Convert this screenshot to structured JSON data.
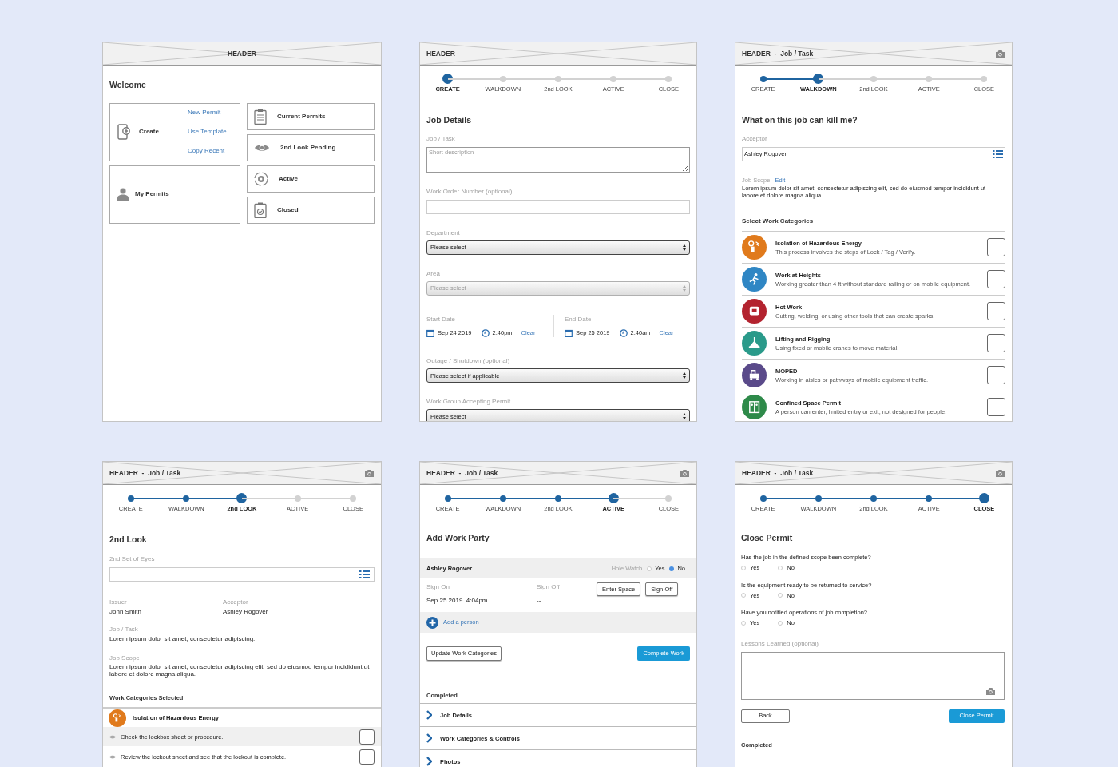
{
  "screens": [
    {
      "kind": "home",
      "header": "HEADER",
      "title": "Welcome",
      "create": {
        "label": "Create",
        "links": [
          "New Permit",
          "Use Template",
          "Copy Recent"
        ]
      },
      "my_permits": "My Permits",
      "tiles": [
        "Current Permits",
        "2nd Look Pending",
        "Active",
        "Closed"
      ]
    },
    {
      "kind": "job_details",
      "header": "HEADER",
      "steps": [
        {
          "label": "CREATE",
          "selected": true
        },
        {
          "label": "WALKDOWN",
          "done": false,
          "selected": false
        },
        {
          "label": "2nd LOOK",
          "done": false,
          "selected": false
        },
        {
          "label": "ACTIVE",
          "done": false,
          "selected": false
        },
        {
          "label": "CLOSE",
          "done": false,
          "selected": false
        }
      ],
      "title": "Job Details",
      "fields": [
        {
          "kind": "textarea",
          "label": "Job / Task",
          "placeholder": "Short description"
        },
        {
          "kind": "input",
          "label": "Work Order Number (optional)"
        },
        {
          "kind": "select",
          "label": "Department",
          "value": "Please select",
          "disabled": false
        },
        {
          "kind": "select",
          "label": "Area",
          "value": "Please select",
          "disabled": true
        },
        {
          "kind": "dates",
          "start": {
            "label": "Start Date",
            "date": "Sep 24 2019",
            "time": "2:40pm",
            "action": "Clear"
          },
          "end": {
            "label": "End Date",
            "date": "Sep 25 2019",
            "time": "2:40am",
            "action": "Clear"
          }
        },
        {
          "kind": "select",
          "label": "Outage / Shutdown (optional)",
          "value": "Please select if applicable",
          "disabled": false
        },
        {
          "kind": "select",
          "label": "Work Group Accepting Permit",
          "value": "Please select",
          "disabled": false
        }
      ]
    },
    {
      "kind": "walkdown",
      "header": "HEADER  -  Job / Task",
      "camera": true,
      "steps": [
        {
          "label": "CREATE",
          "done": true,
          "selected": false
        },
        {
          "label": "WALKDOWN",
          "selected": true
        },
        {
          "label": "2nd LOOK",
          "done": false,
          "selected": false
        },
        {
          "label": "ACTIVE",
          "done": false,
          "selected": false
        },
        {
          "label": "CLOSE",
          "done": false,
          "selected": false
        }
      ],
      "title": "What on this job can kill me?",
      "acceptor": {
        "label": "Acceptor",
        "value": "Ashley Rogover"
      },
      "scope": {
        "label": "Job Scope",
        "action": "Edit",
        "text": "Lorem ipsum dolor sit amet, consectetur adipiscing elit, sed do eiusmod tempor incididunt ut labore et dolore magna aliqua."
      },
      "section": "Select Work Categories",
      "categories": [
        {
          "name": "Isolation of Hazardous Energy",
          "description": "This process involves the steps of Lock / Tag / Verify.",
          "color": "#e07a1c",
          "checked": false
        },
        {
          "name": "Work at Heights",
          "description": "Working greater than 4 ft without standard railing or on mobile equipment.",
          "color": "#2f86c4",
          "checked": false
        },
        {
          "name": "Hot Work",
          "description": "Cutting, welding, or using other tools that can create sparks.",
          "color": "#b3232f",
          "checked": false
        },
        {
          "name": "Lifting and Rigging",
          "description": "Using fixed or mobile cranes to move material.",
          "color": "#2a9a8a",
          "checked": false
        },
        {
          "name": "MOPED",
          "description": "Working in aisles or pathways of mobile equipment traffic.",
          "color": "#5a4a8a",
          "checked": false
        },
        {
          "name": "Confined Space Permit",
          "description": "A person can enter, limited entry or exit, not designed for people.",
          "color": "#2e8a4a",
          "checked": false
        }
      ]
    },
    {
      "kind": "second_look",
      "header": "HEADER  -  Job / Task",
      "camera": true,
      "steps": [
        {
          "label": "CREATE",
          "done": true,
          "selected": false
        },
        {
          "label": "WALKDOWN",
          "done": true,
          "selected": false
        },
        {
          "label": "2nd LOOK",
          "selected": true
        },
        {
          "label": "ACTIVE",
          "done": false,
          "selected": false
        },
        {
          "label": "CLOSE",
          "done": false,
          "selected": false
        }
      ],
      "title": "2nd Look",
      "eyes_label": "2nd Set of Eyes",
      "issuer": {
        "label": "Issuer",
        "value": "John Smith"
      },
      "acceptor": {
        "label": "Acceptor",
        "value": "Ashley Rogover"
      },
      "job_task": {
        "label": "Job / Task",
        "value": "Lorem ipsum dolor sit amet, consectetur adipiscing."
      },
      "job_scope": {
        "label": "Job Scope",
        "value": "Lorem ipsum dolor sit amet, consectetur adipiscing elit, sed do eiusmod tempor incididunt ut labore et dolore magna aliqua."
      },
      "section": "Work Categories Selected",
      "category": {
        "name": "Isolation of Hazardous Energy",
        "color": "#e07a1c"
      },
      "checks": [
        {
          "text": "Check the lockbox sheet or procedure.",
          "checked": false
        },
        {
          "text": "Review the lockout sheet and see that the lockout is complete.",
          "checked": false
        }
      ]
    },
    {
      "kind": "active",
      "header": "HEADER  -  Job / Task",
      "camera": true,
      "steps": [
        {
          "label": "CREATE",
          "done": true,
          "selected": false
        },
        {
          "label": "WALKDOWN",
          "done": true,
          "selected": false
        },
        {
          "label": "2nd LOOK",
          "done": true,
          "selected": false
        },
        {
          "label": "ACTIVE",
          "selected": true
        },
        {
          "label": "CLOSE",
          "done": false,
          "selected": false
        }
      ],
      "title": "Add Work Party",
      "person": {
        "name": "Ashley Rogover",
        "hole_watch": "Hole Watch",
        "options": [
          {
            "label": "Yes",
            "selected": false
          },
          {
            "label": "No",
            "selected": true
          }
        ],
        "sign_on": {
          "label": "Sign On",
          "value": "Sep 25 2019  4:04pm"
        },
        "sign_off": {
          "label": "Sign Off",
          "value": "--"
        },
        "buttons": [
          "Enter Space",
          "Sign Off"
        ]
      },
      "add_person": "Add a person",
      "secondary_button": "Update Work Categories",
      "primary_button": "Complete Work",
      "completed": "Completed",
      "sections": [
        "Job Details",
        "Work Categories & Controls",
        "Photos"
      ]
    },
    {
      "kind": "close",
      "header": "HEADER  -  Job / Task",
      "camera": true,
      "steps": [
        {
          "label": "CREATE",
          "done": true,
          "selected": false
        },
        {
          "label": "WALKDOWN",
          "done": true,
          "selected": false
        },
        {
          "label": "2nd LOOK",
          "done": true,
          "selected": false
        },
        {
          "label": "ACTIVE",
          "done": true,
          "selected": false
        },
        {
          "label": "CLOSE",
          "selected": true
        }
      ],
      "title": "Close Permit",
      "questions": [
        {
          "text": "Has the job in the defined scope been complete?",
          "options": [
            {
              "label": "Yes",
              "selected": false
            },
            {
              "label": "No",
              "selected": false
            }
          ]
        },
        {
          "text": "Is the equipment ready to be returned to service?",
          "options": [
            {
              "label": "Yes",
              "selected": false
            },
            {
              "label": "No",
              "selected": false
            }
          ]
        },
        {
          "text": "Have you notified operations of job completion?",
          "options": [
            {
              "label": "Yes",
              "selected": false
            },
            {
              "label": "No",
              "selected": false
            }
          ]
        }
      ],
      "lessons_label": "Lessons Learned (optional)",
      "back_button": "Back",
      "primary_button": "Close Permit",
      "completed": "Completed"
    }
  ]
}
